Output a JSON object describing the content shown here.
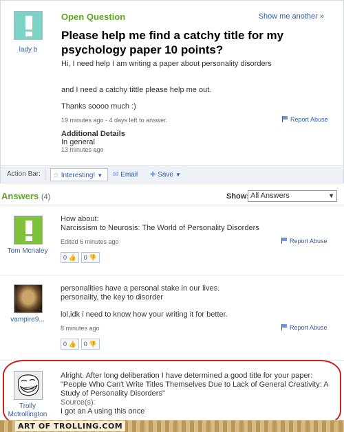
{
  "question": {
    "type_label": "Open Question",
    "show_another": "Show me another »",
    "user": "lady b",
    "title": "Please help me find a catchy title for my psychology paper 10 points?",
    "body": [
      "Hi, I need help I am writing a paper about personality disorders",
      "and I need a catchy tittle please help me out.",
      "Thanks soooo much :)"
    ],
    "meta": "19 minutes ago - 4 days left to answer.",
    "report_abuse": "Report Abuse",
    "additional_details_title": "Additional Details",
    "additional_details_body": "In general",
    "additional_details_meta": "13 minutes ago"
  },
  "action_bar": {
    "label": "Action Bar:",
    "interesting": "Interesting!",
    "email": "Email",
    "save": "Save"
  },
  "answers": {
    "title": "Answers",
    "count": "(4)",
    "show_label": "Show:",
    "show_value": "All Answers",
    "items": [
      {
        "user": "Tom Mcnaley",
        "lines": [
          "How about:",
          "Narcissism to Neurosis: The World of Personality Disorders"
        ],
        "meta": "Edited 6 minutes ago",
        "report": "Report Abuse",
        "up": "0",
        "down": "0"
      },
      {
        "user": "vampire9...",
        "lines": [
          "personalities have a personal stake in our lives.",
          "personality, the key to disorder",
          "lol,idk i need to know how your writing it for better."
        ],
        "meta": "8 minutes ago",
        "report": "Report Abuse",
        "up": "0",
        "down": "0"
      },
      {
        "user": "Trolly Mctrollington",
        "lines": [
          "Alright. After long deliberation I have determined a good title for your paper:",
          "\"People Who Can't Write Titles Themselves Due to Lack of General Creativity: A Study of Personality Disorders\""
        ],
        "sources_label": "Source(s):",
        "source": "I got an A using this once"
      }
    ]
  },
  "footer": {
    "brand": "ART OF TROLLING.COM"
  },
  "colors": {
    "accent_green": "#62a425",
    "link_blue": "#2f5ea3",
    "highlight_red": "#cc2020"
  }
}
